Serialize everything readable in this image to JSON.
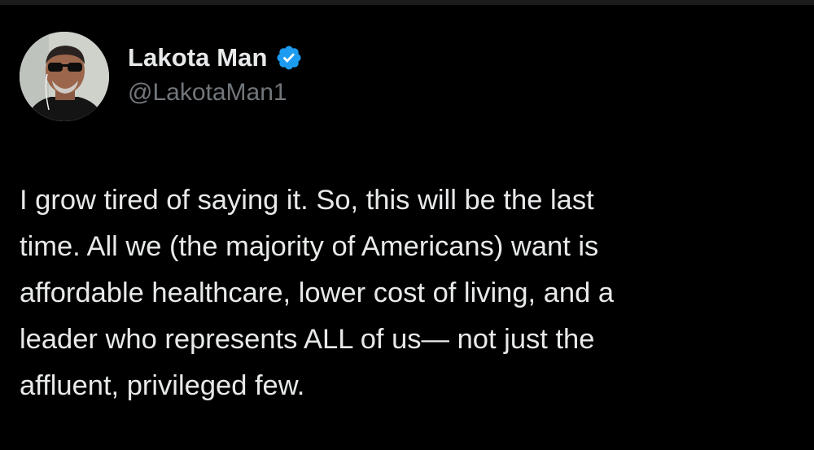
{
  "author": {
    "display_name": "Lakota Man",
    "handle": "@LakotaMan1",
    "verified": true,
    "verified_icon": "verified-badge-icon",
    "avatar_icon": "profile-photo"
  },
  "tweet": {
    "lines": [
      "I grow tired of saying it. So, this will be the last",
      "time. All we (the majority of Americans) want is",
      "affordable healthcare, lower cost of living, and a",
      "leader who represents ALL of us— not just the",
      "affluent, privileged few."
    ]
  },
  "colors": {
    "background": "#000000",
    "text": "#e7e9ea",
    "secondary_text": "#71767b",
    "verified_blue": "#1d9bf0"
  }
}
